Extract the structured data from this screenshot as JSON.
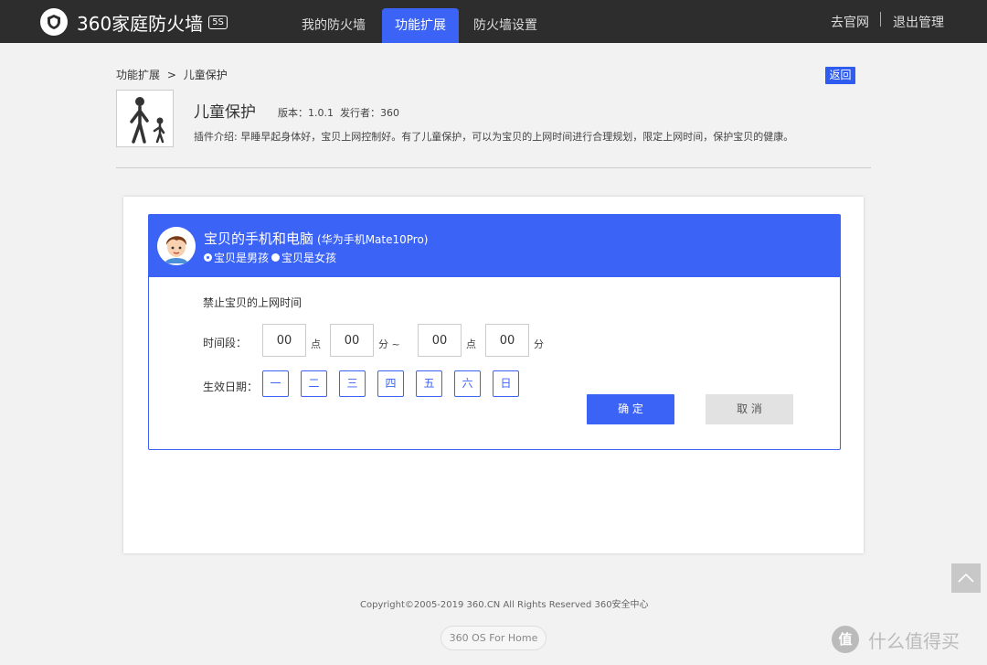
{
  "header": {
    "logo_text": "360家庭防火墙",
    "logo_badge": "5S",
    "tabs": [
      {
        "label": "我的防火墙"
      },
      {
        "label": "功能扩展"
      },
      {
        "label": "防火墙设置"
      }
    ],
    "active_tab": "功能扩展",
    "links": {
      "official_site": "去官网",
      "logout": "退出管理"
    }
  },
  "breadcrumb": {
    "parent": "功能扩展",
    "separator": ">",
    "current": "儿童保护"
  },
  "back_button": "返回",
  "plugin": {
    "title": "儿童保护",
    "version": "版本：1.0.1",
    "publisher": "发行者：360",
    "description": "插件介绍:   早睡早起身体好，宝贝上网控制好。有了儿童保护，可以为宝贝的上网时间进行合理规划，限定上网时间，保护宝贝的健康。"
  },
  "device": {
    "title": "宝贝的手机和电脑",
    "model": "(华为手机Mate10Pro)",
    "gender_options": [
      {
        "label": "宝贝是男孩",
        "checked": true
      },
      {
        "label": "宝贝是女孩",
        "checked": false
      }
    ]
  },
  "form": {
    "forbid_label": "禁止宝贝的上网时间",
    "period_label": "时间段：",
    "start_hour": "00",
    "start_minute": "00",
    "end_hour": "00",
    "end_minute": "00",
    "hour_unit": "点",
    "minute_unit": "分 ~",
    "minute_unit_end": "分",
    "date_label": "生效日期：",
    "days": [
      "一",
      "二",
      "三",
      "四",
      "五",
      "六",
      "日"
    ],
    "confirm": "确 定",
    "cancel": "取 消"
  },
  "footer": {
    "copyright": "Copyright©2005-2019 360.CN All Rights Reserved 360安全中心",
    "os_badge": "360 OS For Home"
  },
  "watermark": {
    "icon": "值",
    "text": "什么值得买"
  },
  "colors": {
    "accent": "#3b63f5",
    "topbar": "#2d2d2d",
    "background": "#f2f2f2"
  }
}
